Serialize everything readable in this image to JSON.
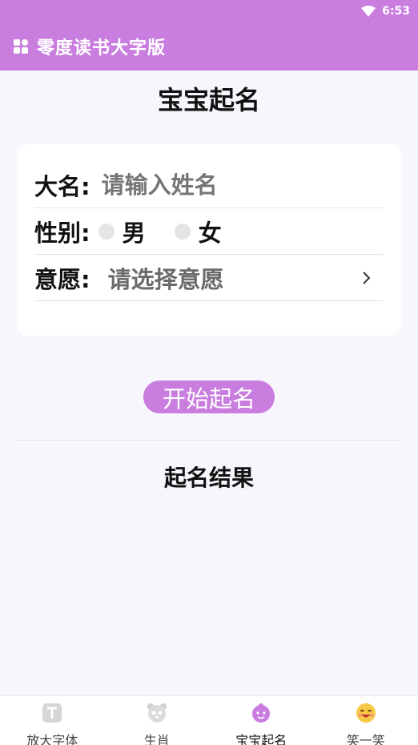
{
  "status_bar": {
    "time": "6:53"
  },
  "app_bar": {
    "title": "零度读书大字版"
  },
  "page": {
    "title": "宝宝起名"
  },
  "form": {
    "name_label": "大名:",
    "name_placeholder": "请输入姓名",
    "gender_label": "性别:",
    "gender_options": [
      "男",
      "女"
    ],
    "wish_label": "意愿:",
    "wish_placeholder": "请选择意愿"
  },
  "start_button": {
    "label": "开始起名"
  },
  "result": {
    "title": "起名结果"
  },
  "bottom_nav": {
    "items": [
      {
        "label": "放大字体",
        "icon": "text-icon"
      },
      {
        "label": "生肖",
        "icon": "panda-icon"
      },
      {
        "label": "宝宝起名",
        "icon": "baby-icon",
        "active": true
      },
      {
        "label": "笑一笑",
        "icon": "smile-icon"
      }
    ]
  },
  "colors": {
    "accent": "#c97ddf",
    "background": "#f6f6fc"
  }
}
